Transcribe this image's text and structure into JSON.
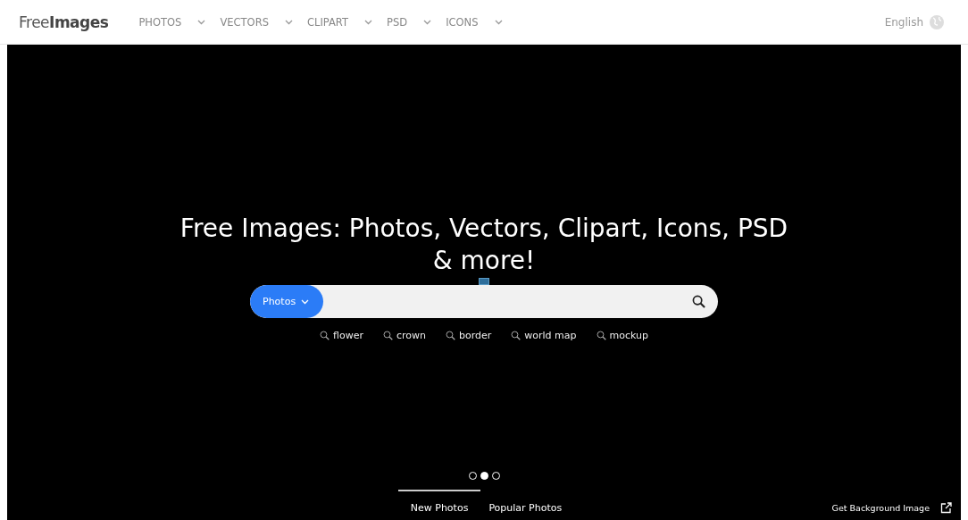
{
  "header": {
    "logo": {
      "part_1": "Free",
      "part_2": "Images"
    },
    "nav": [
      {
        "label": "PHOTOS"
      },
      {
        "label": "VECTORS"
      },
      {
        "label": "CLIPART"
      },
      {
        "label": "PSD"
      },
      {
        "label": "ICONS"
      }
    ],
    "language": "English"
  },
  "hero": {
    "title": "Free Images: Photos, Vectors, Clipart, Icons, PSD & more!",
    "search": {
      "category": "Photos"
    },
    "suggestions": [
      "flower",
      "crown",
      "border",
      "world map",
      "mockup"
    ],
    "slides": [
      {
        "selected": false
      },
      {
        "selected": true
      },
      {
        "selected": false
      }
    ],
    "tabs": [
      {
        "label": "New Photos",
        "selected": true
      },
      {
        "label": "Popular Photos",
        "selected": false
      }
    ],
    "background_link": "Get Background Image"
  }
}
